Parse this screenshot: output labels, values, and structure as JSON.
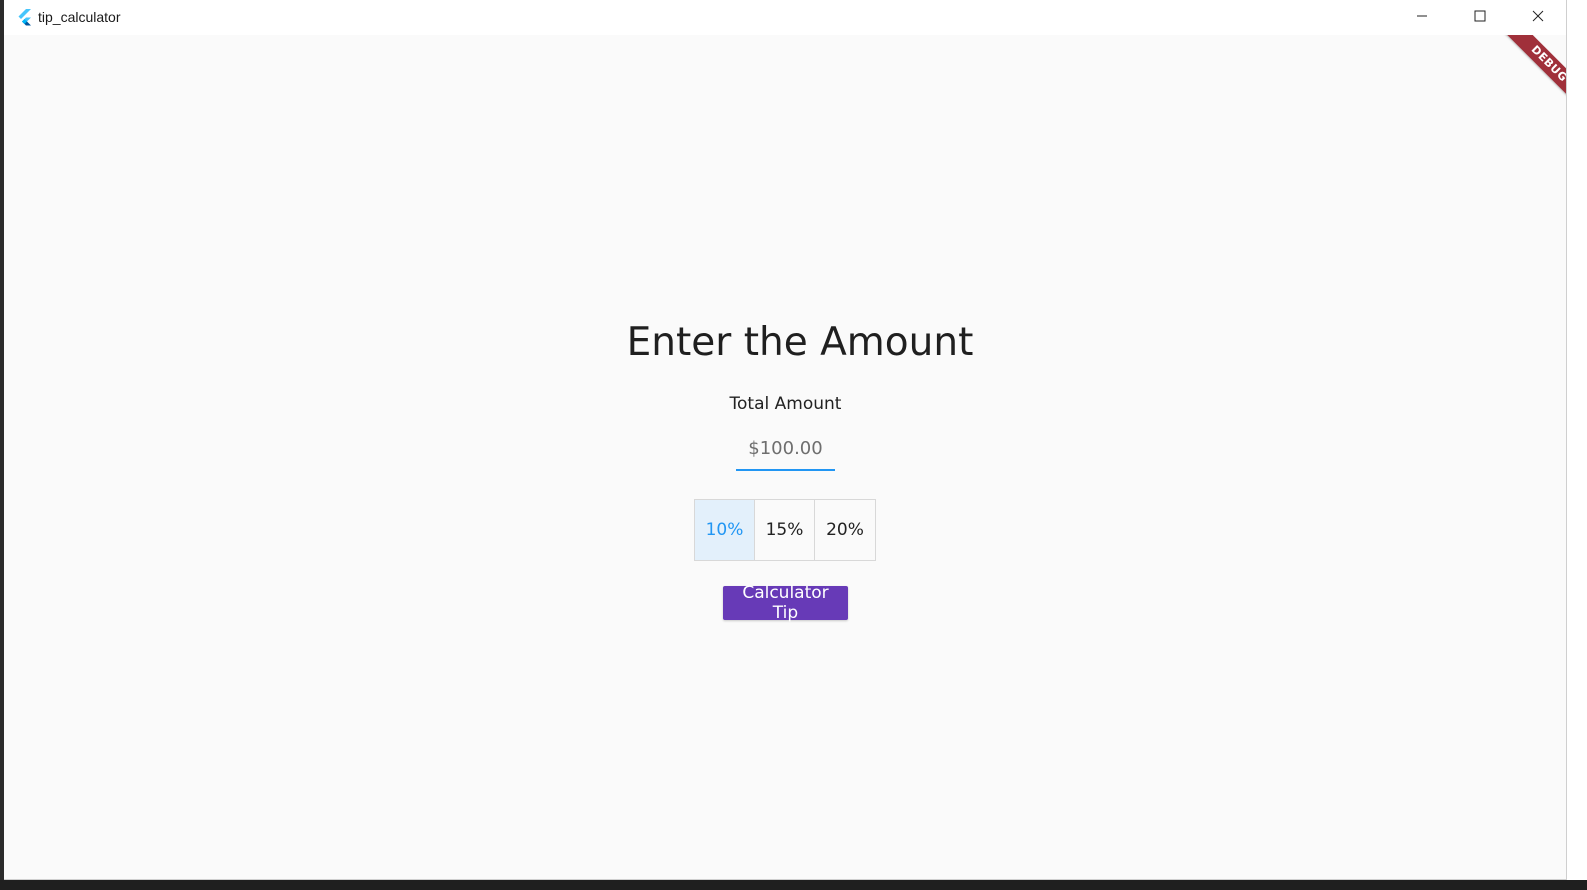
{
  "window": {
    "title": "tip_calculator",
    "controls": {
      "minimize_icon": "minimize-icon",
      "maximize_icon": "maximize-icon",
      "close_icon": "close-icon"
    }
  },
  "debug_banner": {
    "label": "DEBUG",
    "color": "#a0303a"
  },
  "main": {
    "heading": "Enter the Amount",
    "amount_field": {
      "label": "Total Amount",
      "placeholder": "$100.00",
      "value": ""
    },
    "tip_options": [
      {
        "label": "10%",
        "selected": true
      },
      {
        "label": "15%",
        "selected": false
      },
      {
        "label": "20%",
        "selected": false
      }
    ],
    "calculate_button": {
      "label": "Calculator Tip",
      "color": "#673ab7"
    }
  },
  "colors": {
    "accent": "#2196f3",
    "selected_bg": "#e3f0fb",
    "background": "#fafafa"
  }
}
